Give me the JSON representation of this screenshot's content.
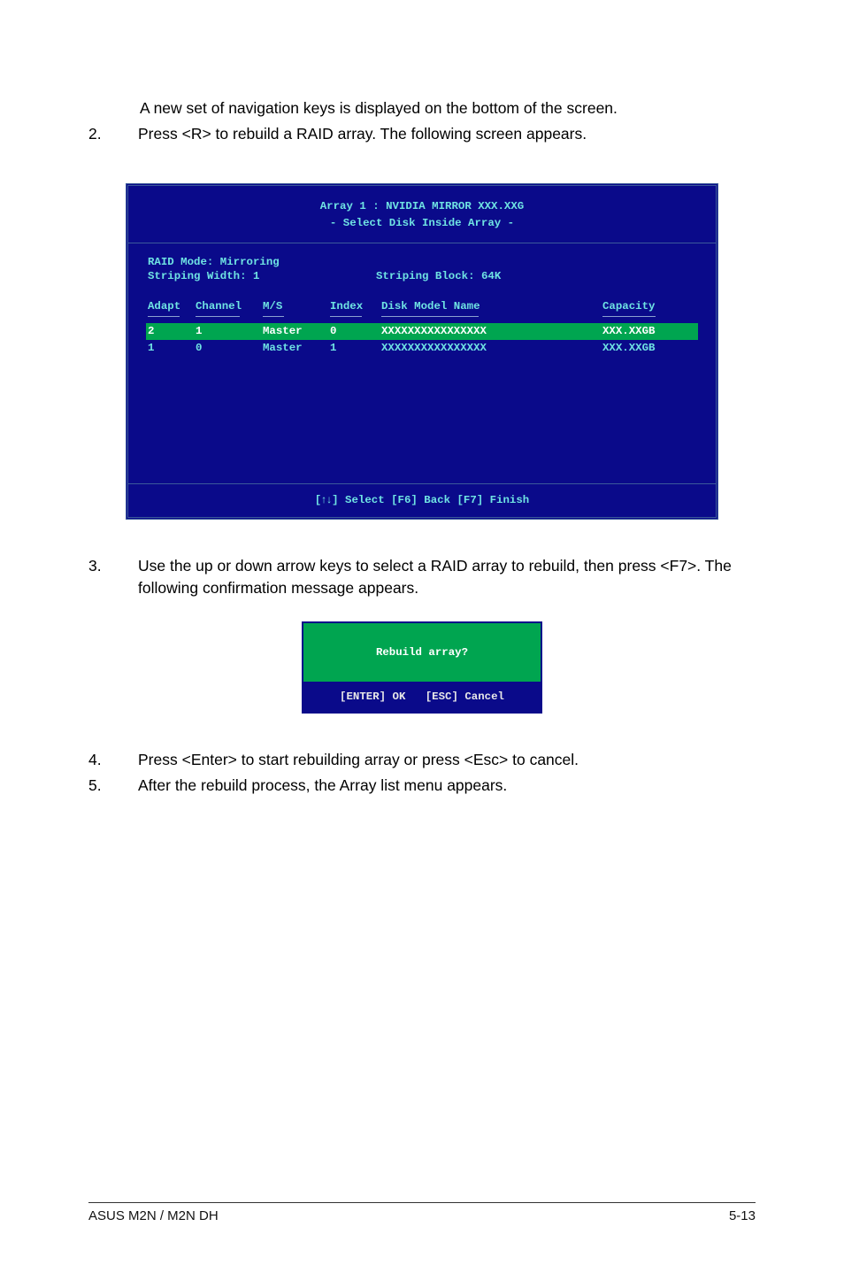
{
  "intro": "A new set of  navigation keys is displayed on the bottom of the screen.",
  "step2": {
    "num": "2.",
    "body": "Press <R> to rebuild a RAID array. The following screen appears."
  },
  "step3": {
    "num": "3.",
    "body": "Use the up or down arrow keys to select a RAID array to rebuild, then press <F7>. The following confirmation message appears."
  },
  "step4": {
    "num": "4.",
    "body": "Press <Enter> to start rebuilding array or press <Esc> to cancel."
  },
  "step5": {
    "num": "5.",
    "body": "After the rebuild process, the Array list menu appears."
  },
  "terminal": {
    "title1": "Array 1 : NVIDIA MIRROR  XXX.XXG",
    "title2": "- Select Disk Inside Array -",
    "raid_mode": "RAID Mode: Mirroring",
    "striping_width": "Striping Width: 1",
    "striping_block": "Striping Block: 64K",
    "headers": {
      "adapt": "Adapt",
      "channel": "Channel",
      "ms": "M/S",
      "index": "Index",
      "model": "Disk Model Name",
      "cap": "Capacity"
    },
    "rows": [
      {
        "adapt": "2",
        "channel": "1",
        "ms": "Master",
        "index": "0",
        "model": "XXXXXXXXXXXXXXXX",
        "cap": "XXX.XXGB"
      },
      {
        "adapt": "1",
        "channel": "0",
        "ms": "Master",
        "index": "1",
        "model": "XXXXXXXXXXXXXXXX",
        "cap": "XXX.XXGB"
      }
    ],
    "footer": "] Select [F6] Back  [F7] Finish",
    "footer_prefix": "["
  },
  "dialog": {
    "question": "Rebuild array?",
    "buttons": "[ENTER] OK   [ESC] Cancel"
  },
  "page_footer": {
    "left": "ASUS M2N / M2N DH",
    "right": "5-13"
  }
}
